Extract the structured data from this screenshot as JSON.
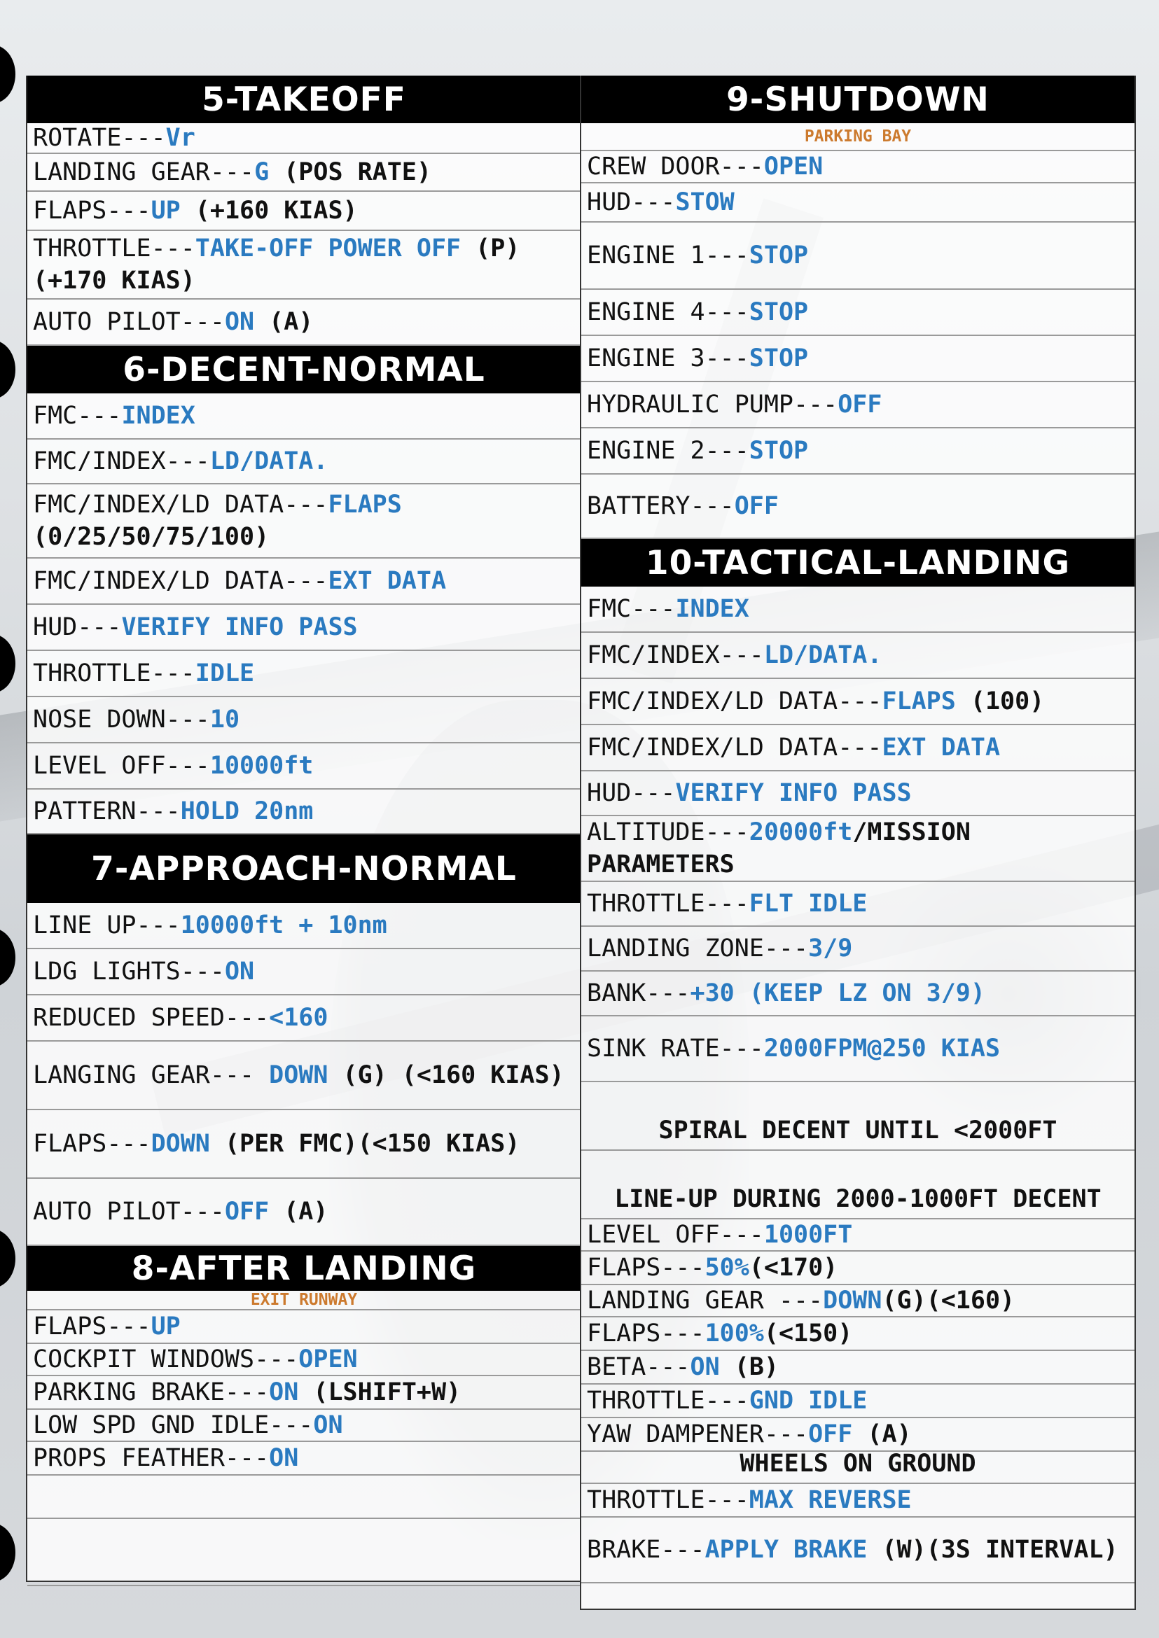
{
  "left_column": {
    "sections": [
      {
        "title": "5-TAKEOFF",
        "rows": [
          {
            "label": "ROTATE---",
            "value": "Vr",
            "suffix": ""
          },
          {
            "label": "LANDING GEAR---",
            "value": "G",
            "suffix": " (POS RATE)"
          },
          {
            "label": "FLAPS---",
            "value": "UP",
            "suffix": " (+160 KIAS)"
          },
          {
            "label": "THROTTLE---",
            "value": "TAKE-OFF POWER OFF",
            "suffix": " (P)(+170 KIAS)"
          },
          {
            "label": "AUTO PILOT---",
            "value": "ON",
            "suffix": " (A)"
          }
        ]
      },
      {
        "title": "6-DECENT-NORMAL",
        "rows": [
          {
            "label": "FMC---",
            "value": "INDEX",
            "suffix": ""
          },
          {
            "label": "FMC/INDEX---",
            "value": "LD/DATA.",
            "suffix": ""
          },
          {
            "label": "FMC/INDEX/LD DATA---",
            "value": "FLAPS",
            "suffix": " (0/25/50/75/100)"
          },
          {
            "label": "FMC/INDEX/LD DATA---",
            "value": "EXT DATA",
            "suffix": ""
          },
          {
            "label": "HUD---",
            "value": "VERIFY INFO PASS",
            "suffix": ""
          },
          {
            "label": "THROTTLE---",
            "value": "IDLE",
            "suffix": ""
          },
          {
            "label": "NOSE DOWN---",
            "value": "10",
            "suffix": ""
          },
          {
            "label": "LEVEL OFF---",
            "value": "10000ft",
            "suffix": ""
          },
          {
            "label": "PATTERN---",
            "value": "HOLD 20nm",
            "suffix": ""
          }
        ]
      },
      {
        "title": "7-APPROACH-NORMAL",
        "rows": [
          {
            "label": "LINE UP---",
            "value": "10000ft + 10nm",
            "suffix": ""
          },
          {
            "label": "LDG LIGHTS---",
            "value": "ON",
            "suffix": ""
          },
          {
            "label": "REDUCED SPEED---",
            "value": "<160",
            "suffix": ""
          },
          {
            "label": "LANGING GEAR--- ",
            "value": "DOWN",
            "suffix": " (G) (<160 KIAS)"
          },
          {
            "label": "FLAPS---",
            "value": "DOWN",
            "suffix": " (PER FMC)(<150 KIAS)"
          },
          {
            "label": "AUTO PILOT---",
            "value": "OFF",
            "suffix": " (A)"
          }
        ]
      },
      {
        "title": "8-AFTER LANDING",
        "subtitle": "EXIT RUNWAY",
        "rows": [
          {
            "label": "FLAPS---",
            "value": "UP",
            "suffix": ""
          },
          {
            "label": "COCKPIT WINDOWS---",
            "value": "OPEN",
            "suffix": ""
          },
          {
            "label": "PARKING BRAKE---",
            "value": "ON",
            "suffix": " (LSHIFT+W)"
          },
          {
            "label": "LOW SPD GND IDLE---",
            "value": "ON",
            "suffix": ""
          },
          {
            "label": "PROPS FEATHER---",
            "value": "ON",
            "suffix": ""
          }
        ]
      }
    ]
  },
  "right_column": {
    "sections": [
      {
        "title": "9-SHUTDOWN",
        "subtitle": "PARKING BAY",
        "rows": [
          {
            "label": "CREW DOOR---",
            "value": "OPEN",
            "suffix": ""
          },
          {
            "label": "HUD---",
            "value": "STOW",
            "suffix": ""
          },
          {
            "label": "ENGINE 1---",
            "value": "STOP",
            "suffix": ""
          },
          {
            "label": "ENGINE 4---",
            "value": "STOP",
            "suffix": ""
          },
          {
            "label": "ENGINE 3---",
            "value": "STOP",
            "suffix": ""
          },
          {
            "label": "HYDRAULIC PUMP---",
            "value": "OFF",
            "suffix": ""
          },
          {
            "label": "ENGINE 2---",
            "value": "STOP",
            "suffix": ""
          },
          {
            "label": "BATTERY---",
            "value": "OFF",
            "suffix": ""
          }
        ]
      },
      {
        "title": "10-TACTICAL-LANDING",
        "rows": [
          {
            "label": "FMC---",
            "value": "INDEX",
            "suffix": ""
          },
          {
            "label": "FMC/INDEX---",
            "value": "LD/DATA.",
            "suffix": ""
          },
          {
            "label": "FMC/INDEX/LD DATA---",
            "value": "FLAPS",
            "suffix": " (100)"
          },
          {
            "label": "FMC/INDEX/LD DATA---",
            "value": "EXT DATA",
            "suffix": ""
          },
          {
            "label": "HUD---",
            "value": "VERIFY INFO PASS",
            "suffix": ""
          },
          {
            "label": "ALTITUDE---",
            "value": "20000ft",
            "suffix": "/MISSION PARAMETERS"
          },
          {
            "label": "THROTTLE---",
            "value": "FLT IDLE",
            "suffix": ""
          },
          {
            "label": "LANDING ZONE---",
            "value": "3/9",
            "suffix": ""
          },
          {
            "label": "BANK---",
            "value": "+30 (KEEP LZ ON 3/9)",
            "suffix": ""
          },
          {
            "label": "SINK RATE---",
            "value": "2000FPM@250 KIAS",
            "suffix": ""
          },
          {
            "note": "SPIRAL DECENT UNTIL <2000FT"
          },
          {
            "note": "LINE-UP DURING 2000-1000FT DECENT"
          },
          {
            "label": "LEVEL OFF---",
            "value": "1000FT",
            "suffix": ""
          },
          {
            "label": "FLAPS---",
            "value": "50%",
            "suffix": "(<170)"
          },
          {
            "label": "LANDING GEAR ---",
            "value": "DOWN",
            "suffix": "(G)(<160)"
          },
          {
            "label": "FLAPS---",
            "value": "100%",
            "suffix": "(<150)"
          },
          {
            "label": "BETA---",
            "value": "ON",
            "suffix": " (B)"
          },
          {
            "label": "THROTTLE---",
            "value": "GND IDLE",
            "suffix": ""
          },
          {
            "label": "YAW DAMPENER---",
            "value": "OFF",
            "suffix": " (A)"
          },
          {
            "note": "WHEELS ON GROUND"
          },
          {
            "label": "THROTTLE---",
            "value": "MAX REVERSE",
            "suffix": ""
          },
          {
            "label": "BRAKE---",
            "value": "APPLY BRAKE",
            "suffix": " (W)(3S INTERVAL)"
          }
        ]
      }
    ]
  },
  "colors": {
    "header_bg": "#000000",
    "value": "#2a7ac0",
    "subtitle": "#cc7a2e"
  }
}
